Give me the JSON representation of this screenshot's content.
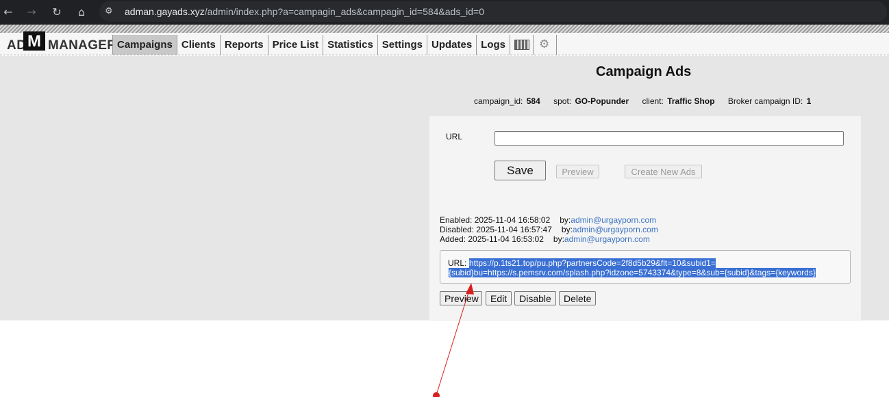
{
  "browser": {
    "url_host": "adman.gayads.xyz",
    "url_path": "/admin/index.php?a=campagin_ads&campagin_id=584&ads_id=0"
  },
  "logo": {
    "part1": "AD",
    "part2": "M",
    "part3": "MANAGER"
  },
  "menu": {
    "items": [
      {
        "label": "Campaigns",
        "active": true
      },
      {
        "label": "Clients"
      },
      {
        "label": "Reports"
      },
      {
        "label": "Price List"
      },
      {
        "label": "Statistics"
      },
      {
        "label": "Settings"
      },
      {
        "label": "Updates"
      },
      {
        "label": "Logs"
      }
    ],
    "icons": [
      "calculator-icon",
      "search-gear-icon"
    ]
  },
  "page": {
    "title": "Campaign Ads",
    "info": {
      "campaign_id_label": "campaign_id:",
      "campaign_id": "584",
      "spot_label": "spot:",
      "spot": "GO-Popunder",
      "client_label": "client:",
      "client": "Traffic Shop",
      "broker_label": "Broker campaign ID:",
      "broker_id": "1"
    }
  },
  "form": {
    "url_label": "URL",
    "url_value": "",
    "save_label": "Save",
    "preview_label": "Preview",
    "create_label": "Create New Ads"
  },
  "log": {
    "enabled": {
      "text": "Enabled: 2025-11-04 16:58:02",
      "by": "by:",
      "user": "admin@urgayporn.com"
    },
    "disabled": {
      "text": "Disabled: 2025-11-04 16:57:47",
      "by": "by:",
      "user": "admin@urgayporn.com"
    },
    "added": {
      "text": "Added: 2025-11-04 16:53:02",
      "by": "by:",
      "user": "admin@urgayporn.com"
    }
  },
  "ad": {
    "url_label": "URL:",
    "url_line1": "https://p.1ts21.top/pu.php?partnersCode=2f8d5b29&flt=10&subid1=",
    "url_line2": "{subid}bu=https://s.pemsrv.com/splash.php?idzone=5743374&type=8&sub={subid}&tags={keywords}"
  },
  "ad_actions": {
    "preview": "Preview",
    "edit": "Edit",
    "disable": "Disable",
    "delete": "Delete"
  },
  "annotation_color": "#d91e1e"
}
